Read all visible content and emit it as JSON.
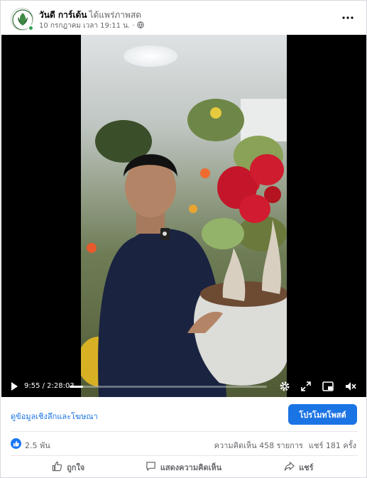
{
  "post": {
    "page_name": "วันดี การ์เด้น",
    "live_label": "ได้แพร่ภาพสด",
    "date": "10 กรกฎาคม เวลา 19:11 น. ·",
    "privacy_icon": "globe-icon"
  },
  "video": {
    "current_time": "9:55 / 2:28:03",
    "progress": 0.067
  },
  "ad_row": {
    "insights_label": "ดูข้อมูลเชิงลึกและโฆษณา",
    "promote_label": "โปรโมทโพสต์",
    "promote_color": "#1b74e4"
  },
  "stats": {
    "likes": "2.5 พัน",
    "comments": "ความคิดเห็น 458 รายการ",
    "shares": "แชร์ 181 ครั้ง"
  },
  "actions": {
    "like": "ถูกใจ",
    "comment": "แสดงความคิดเห็น",
    "share": "แชร์"
  }
}
